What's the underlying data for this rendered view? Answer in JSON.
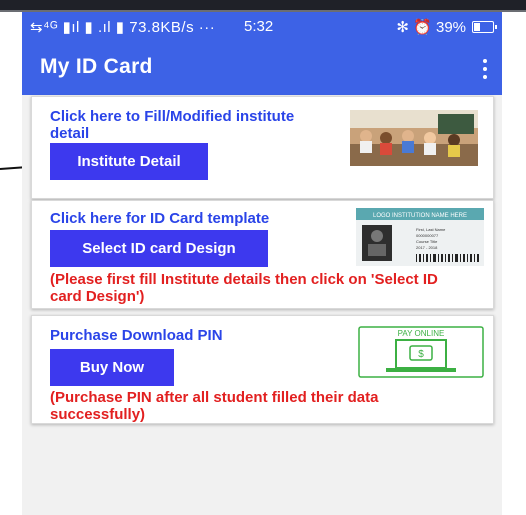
{
  "status_bar": {
    "network": "⇆⁴ᴳ ▮ıl ▮ .ıl ▮ 73.8KB/s ···",
    "time": "5:32",
    "indicators": "✻ ⏰ 39%",
    "battery_level": 0.39
  },
  "app_bar": {
    "title": "My ID Card"
  },
  "cards": {
    "institute": {
      "title": "Click here to Fill/Modified institute detail",
      "button": "Institute Detail"
    },
    "template": {
      "title": "Click here for ID Card template",
      "button": "Select ID card Design",
      "note": "(Please first fill Institute details then click on 'Select ID card Design')",
      "id_card_header": "LOGO INSTITUTION NAME HERE",
      "id_card_fields": [
        "First, Last Name",
        "0000000077",
        "Course Title",
        "2017 - 2018"
      ]
    },
    "purchase": {
      "title": "Purchase Download PIN",
      "button": "Buy Now",
      "note": "(Purchase PIN after all student filled their data successfully)",
      "pay_label": "PAY ONLINE"
    }
  },
  "colors": {
    "primary": "#3d62e6",
    "button": "#3d39ee",
    "title_text": "#2a44e8",
    "warning_text": "#e22020",
    "pay_green": "#3cb043"
  }
}
